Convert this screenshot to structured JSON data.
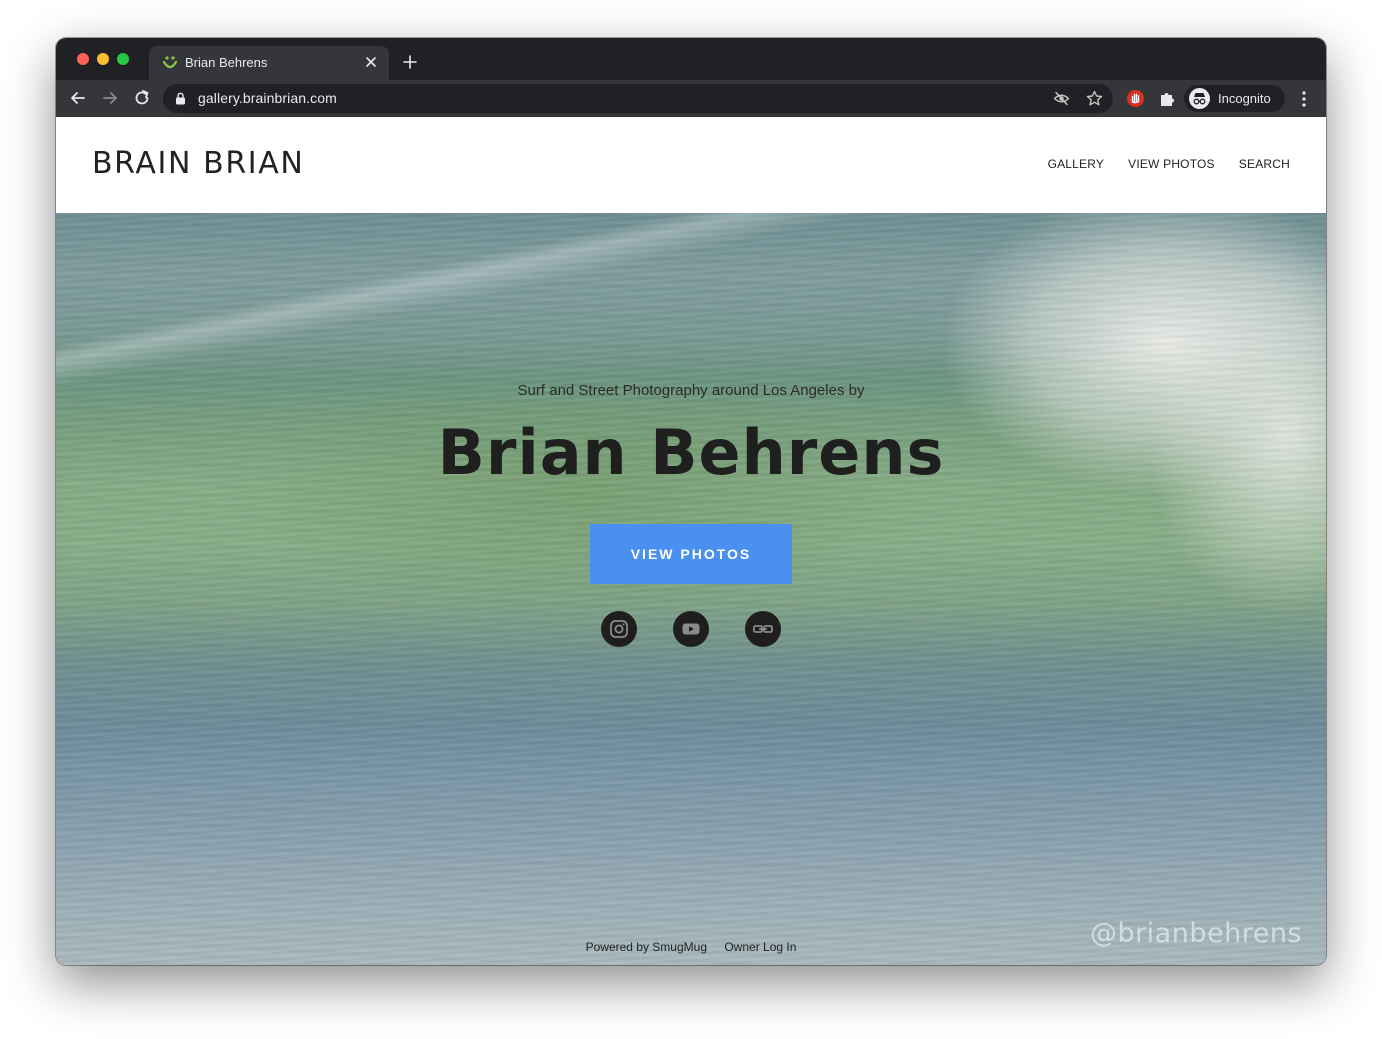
{
  "browser": {
    "tab": {
      "title": "Brian Behrens"
    },
    "address": {
      "url": "gallery.brainbrian.com"
    },
    "profile": {
      "label": "Incognito"
    }
  },
  "site": {
    "logo": "BRAIN BRIAN",
    "nav": [
      {
        "label": "GALLERY"
      },
      {
        "label": "VIEW PHOTOS"
      },
      {
        "label": "SEARCH"
      }
    ]
  },
  "hero": {
    "subtitle": "Surf and Street Photography around Los Angeles by",
    "title": "Brian Behrens",
    "cta": "VIEW PHOTOS",
    "watermark": "@brianbehrens",
    "social": [
      {
        "icon": "instagram-icon"
      },
      {
        "icon": "youtube-icon"
      },
      {
        "icon": "link-icon"
      }
    ]
  },
  "footer": {
    "powered": "Powered by SmugMug",
    "login": "Owner Log In"
  },
  "colors": {
    "cta": "#4a90f0",
    "chrome_dark": "#202124",
    "chrome_toolbar": "#35363a"
  }
}
